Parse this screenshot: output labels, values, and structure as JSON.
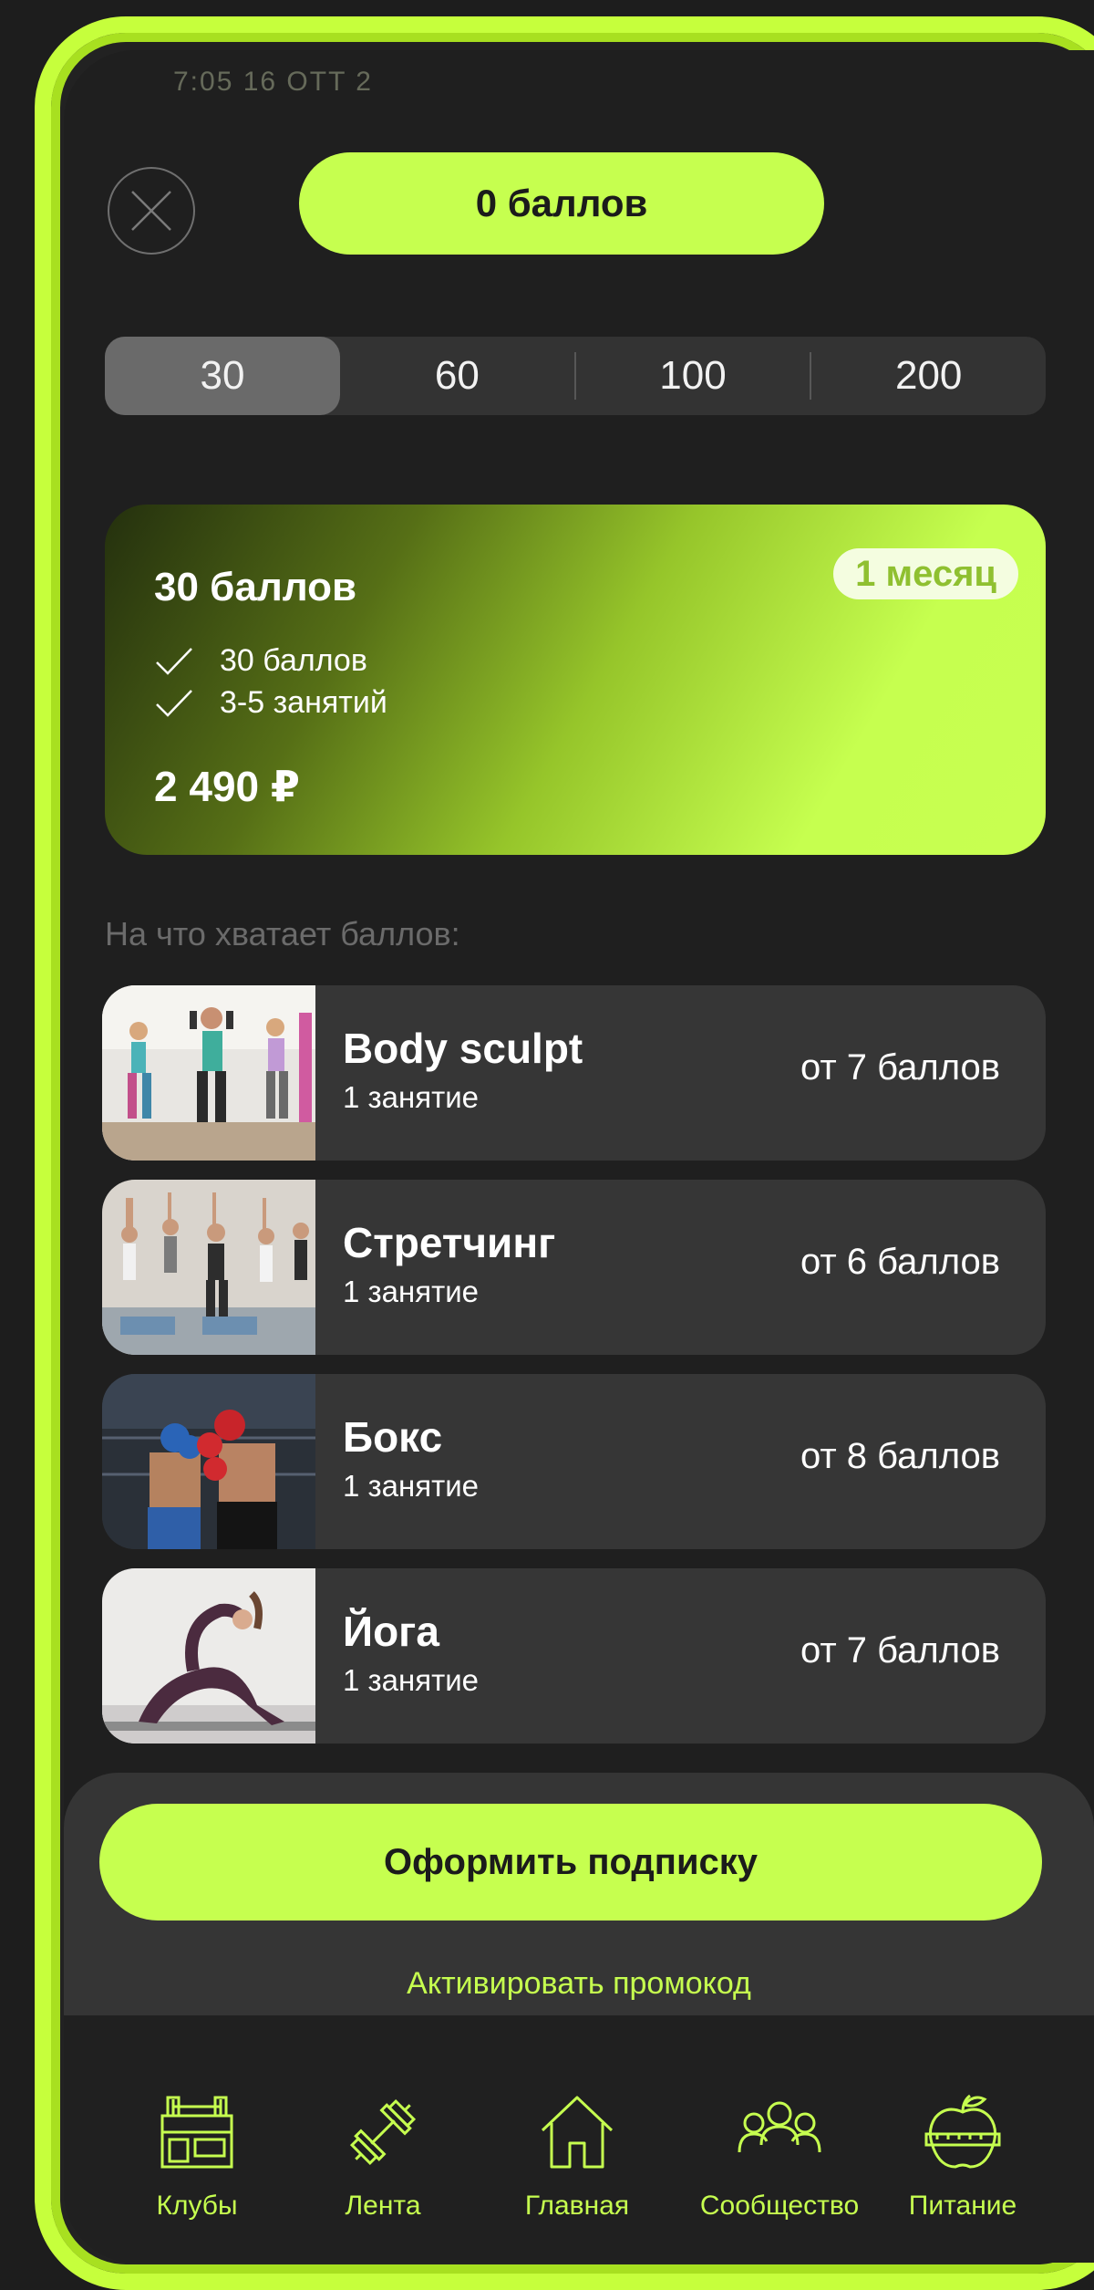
{
  "status_ghost": "7:05 16 OTT 2",
  "header": {
    "points_label": "0 баллов"
  },
  "periods": [
    "30",
    "60",
    "100",
    "200"
  ],
  "plan": {
    "title": "30 баллов",
    "badge": "1 месяц",
    "features": [
      "30 баллов",
      "3-5 занятий"
    ],
    "price": "2 490 ₽"
  },
  "section_label": "На что хватает баллов:",
  "activities": [
    {
      "name": "Body sculpt",
      "sub": "1 занятие",
      "cost": "от 7 баллов",
      "image": "group-fitness-photo"
    },
    {
      "name": "Стретчинг",
      "sub": "1 занятие",
      "cost": "от 6 баллов",
      "image": "stretching-class-photo"
    },
    {
      "name": "Бокс",
      "sub": "1 занятие",
      "cost": "от 8 баллов",
      "image": "boxing-photo"
    },
    {
      "name": "Йога",
      "sub": "1 занятие",
      "cost": "от 7 баллов",
      "image": "yoga-photo"
    }
  ],
  "cta_label": "Оформить подписку",
  "promo_label": "Активировать промокод",
  "tabs": [
    {
      "label": "Клубы",
      "icon": "club-icon"
    },
    {
      "label": "Лента",
      "icon": "dumbbell-icon"
    },
    {
      "label": "Главная",
      "icon": "home-icon"
    },
    {
      "label": "Сообщество",
      "icon": "community-icon"
    },
    {
      "label": "Питание",
      "icon": "apple-icon"
    }
  ],
  "colors": {
    "accent": "#c6ff4f",
    "background": "#1f1f1f",
    "card": "#363636",
    "badge_text": "#8fc030"
  }
}
